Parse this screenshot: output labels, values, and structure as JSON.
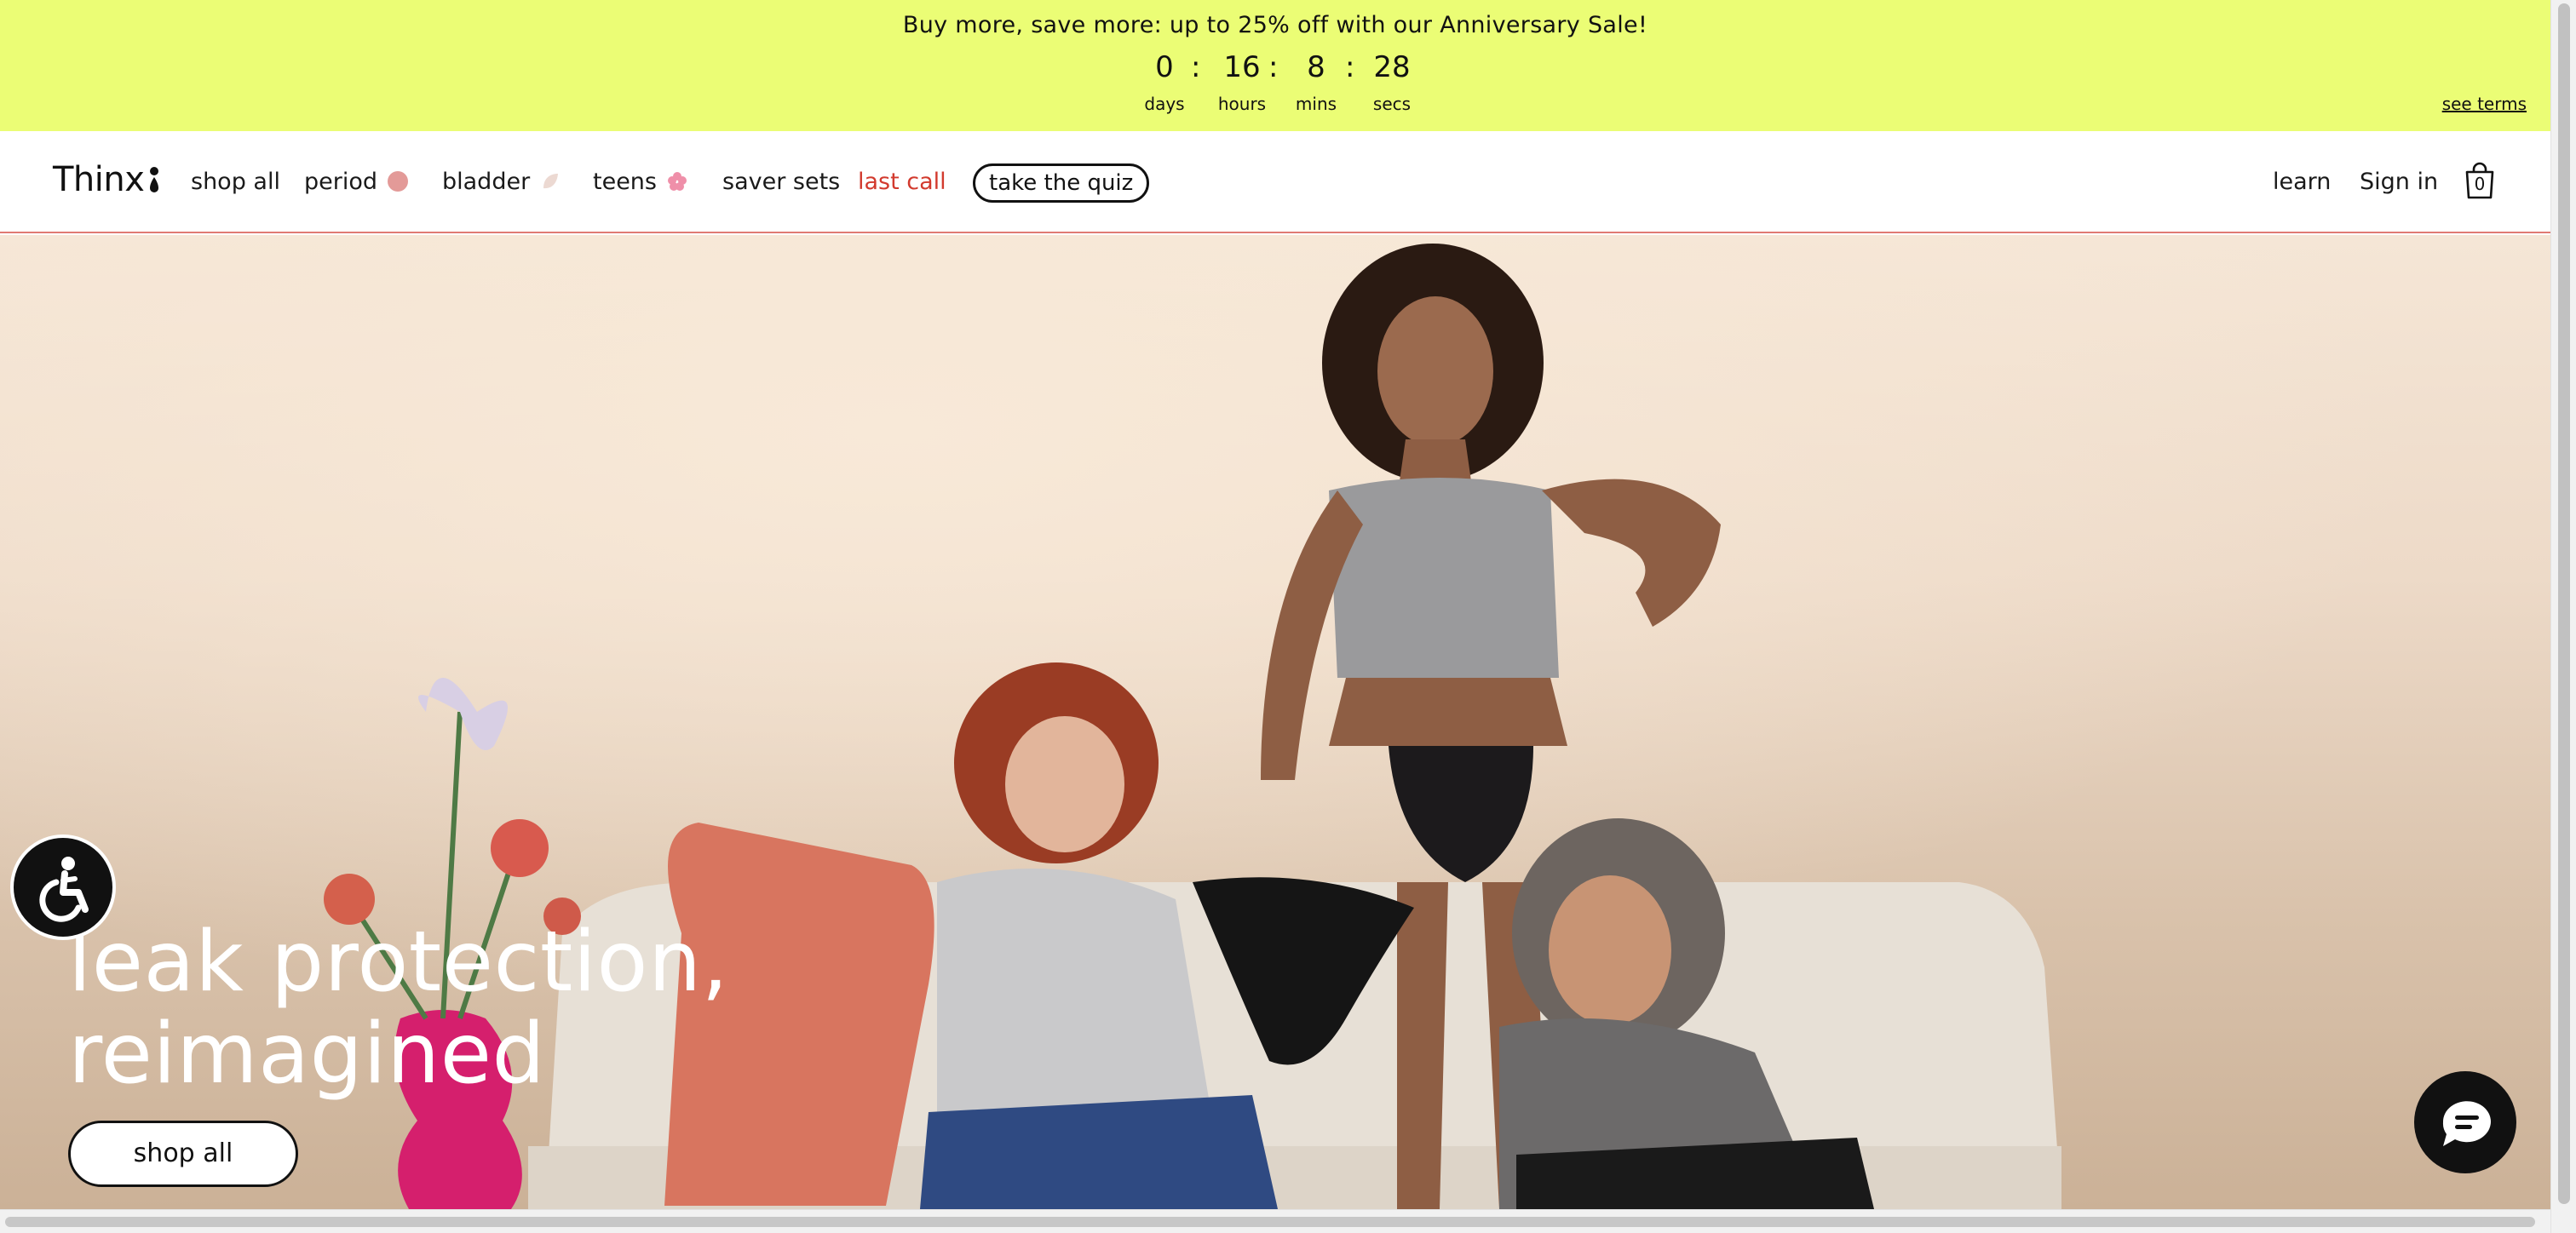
{
  "announcement": {
    "text": "Buy more, save more: up to 25% off with our  Anniversary Sale!",
    "countdown": [
      {
        "value": "0",
        "label": "days"
      },
      {
        "value": "16",
        "label": "hours"
      },
      {
        "value": "8",
        "label": "mins"
      },
      {
        "value": "28",
        "label": "secs"
      }
    ],
    "separator": ":",
    "terms_link": "see terms",
    "background": "#ebfd75"
  },
  "header": {
    "logo": "Thinx",
    "nav": [
      {
        "label": "shop all"
      },
      {
        "label": "period",
        "dot_color": "#e39a98"
      },
      {
        "label": "bladder",
        "dot_color": "#ecd9d2"
      },
      {
        "label": "teens",
        "dot_color": "#ef8fa9"
      },
      {
        "label": "saver sets"
      },
      {
        "label": "last call",
        "color": "#d23a2e"
      }
    ],
    "quiz_button": "take the quiz",
    "learn": "learn",
    "sign_in": "Sign in",
    "cart_count": "0"
  },
  "hero": {
    "title_line1": "leak protection,",
    "title_line2": "reimagined",
    "cta": "shop all"
  }
}
